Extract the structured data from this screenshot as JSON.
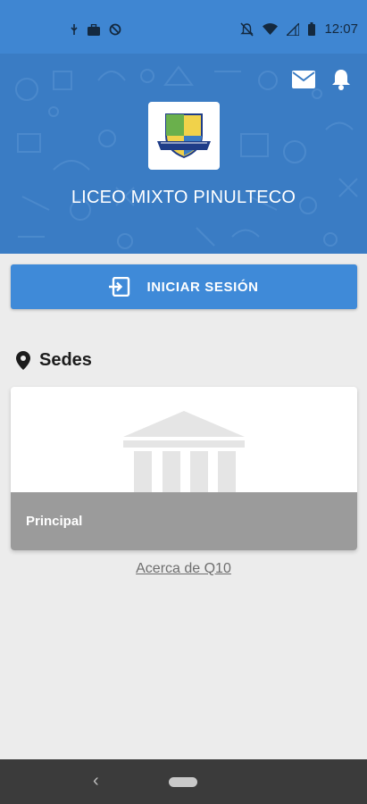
{
  "status_bar": {
    "time": "12:07",
    "left_icons": [
      "usb-icon",
      "briefcase-icon",
      "blocked-circle-icon"
    ],
    "right_icons": [
      "bell-off-icon",
      "wifi-icon",
      "signal-icon",
      "battery-icon"
    ]
  },
  "header": {
    "school_name": "LICEO MIXTO PINULTECO",
    "actions": [
      "mail-icon",
      "bell-icon"
    ]
  },
  "login": {
    "label": "INICIAR SESIÓN",
    "icon": "login-icon"
  },
  "sedes": {
    "title": "Sedes",
    "icon": "location-pin-icon",
    "items": [
      {
        "label": "Principal",
        "icon": "building-icon"
      }
    ]
  },
  "footer": {
    "about_link": "Acerca de Q10"
  },
  "colors": {
    "header_blue": "#3a7cc4",
    "status_blue": "#3f86d2",
    "button_blue": "#3f8ad8",
    "background": "#ececec"
  }
}
